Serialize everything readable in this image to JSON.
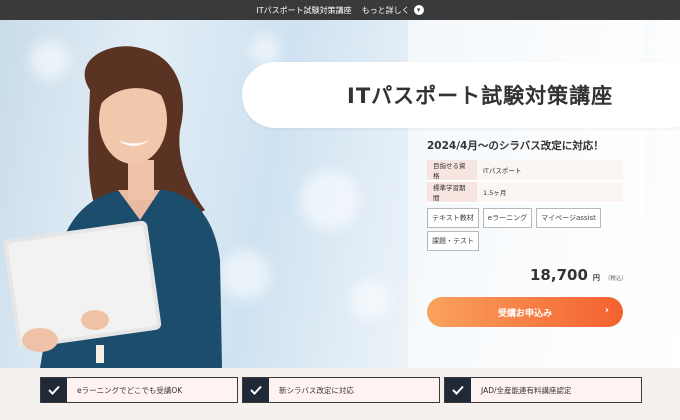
{
  "topbar": {
    "title": "ITパスポート試験対策講座",
    "more_label": "もっと詳しく"
  },
  "hero": {
    "course_title": "ITパスポート試験対策講座",
    "notice": "2024/4月〜のシラバス改定に対応！",
    "info": [
      {
        "key": "目指せる資格",
        "value": "ITパスポート"
      },
      {
        "key": "標準学習期間",
        "value": "1.5ヶ月"
      }
    ],
    "tags": [
      "テキスト教材",
      "eラーニング",
      "マイページassist",
      "課題・テスト"
    ],
    "price": {
      "amount": "18,700",
      "unit": "円",
      "tax": "（税込）"
    },
    "cta_label": "受講お申込み"
  },
  "features": [
    {
      "label": "eラーニングでどこでも受講OK"
    },
    {
      "label": "新シラバス改定に対応"
    },
    {
      "label": "JAD/全産能連有料講座認定"
    }
  ],
  "colors": {
    "topbar": "#3a3a3a",
    "accent_start": "#f9a25e",
    "accent_end": "#f3612f",
    "check_box": "#1f2a36",
    "info_key_bg": "#f6e6df"
  }
}
